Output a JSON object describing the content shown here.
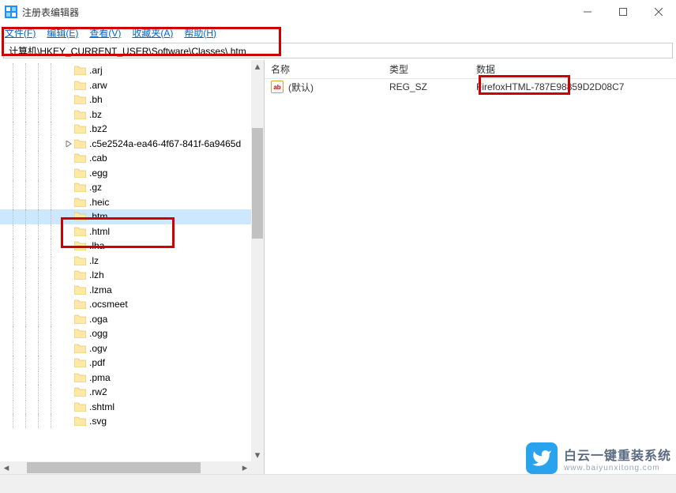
{
  "window": {
    "title": "注册表编辑器"
  },
  "menu": {
    "file": "文件(F)",
    "edit": "编辑(E)",
    "view": "查看(V)",
    "favorites": "收藏夹(A)",
    "help": "帮助(H)"
  },
  "address": "计算机\\HKEY_CURRENT_USER\\Software\\Classes\\.htm",
  "tree": {
    "items": [
      {
        "label": ".arj",
        "exp": ""
      },
      {
        "label": ".arw",
        "exp": ""
      },
      {
        "label": ".bh",
        "exp": ""
      },
      {
        "label": ".bz",
        "exp": ""
      },
      {
        "label": ".bz2",
        "exp": ""
      },
      {
        "label": ".c5e2524a-ea46-4f67-841f-6a9465d",
        "exp": ">"
      },
      {
        "label": ".cab",
        "exp": ""
      },
      {
        "label": ".egg",
        "exp": ""
      },
      {
        "label": ".gz",
        "exp": ""
      },
      {
        "label": ".heic",
        "exp": ""
      },
      {
        "label": ".htm",
        "exp": "",
        "selected": true
      },
      {
        "label": ".html",
        "exp": ""
      },
      {
        "label": ".lha",
        "exp": ""
      },
      {
        "label": ".lz",
        "exp": ""
      },
      {
        "label": ".lzh",
        "exp": ""
      },
      {
        "label": ".lzma",
        "exp": ""
      },
      {
        "label": ".ocsmeet",
        "exp": ""
      },
      {
        "label": ".oga",
        "exp": ""
      },
      {
        "label": ".ogg",
        "exp": ""
      },
      {
        "label": ".ogv",
        "exp": ""
      },
      {
        "label": ".pdf",
        "exp": ""
      },
      {
        "label": ".pma",
        "exp": ""
      },
      {
        "label": ".rw2",
        "exp": ""
      },
      {
        "label": ".shtml",
        "exp": ""
      },
      {
        "label": ".svg",
        "exp": ""
      }
    ]
  },
  "columns": {
    "name": "名称",
    "type": "类型",
    "data": "数据"
  },
  "values": [
    {
      "name": "(默认)",
      "type": "REG_SZ",
      "data": "FirefoxHTML-787E98859D2D08C7"
    }
  ],
  "watermark": {
    "line1": "白云一键重装系统",
    "line2": "www.baiyunxitong.com"
  }
}
